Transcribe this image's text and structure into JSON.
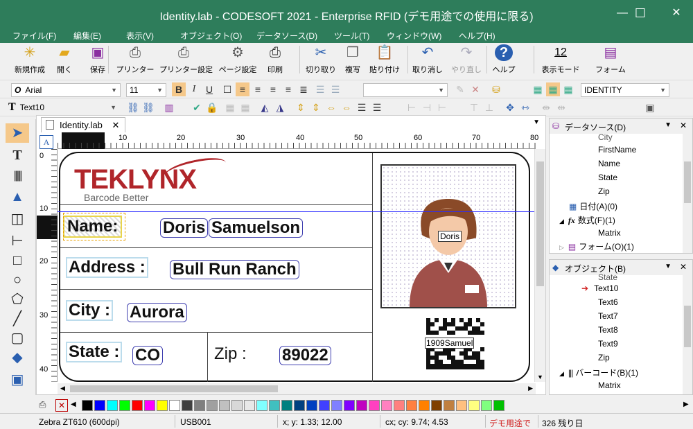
{
  "window": {
    "title": "Identity.lab - CODESOFT 2021 - Enterprise RFID (デモ用途での使用に限る)",
    "minimize": "—",
    "maximize": "☐",
    "close": "✕"
  },
  "menu": [
    "ファイル(F)",
    "編集(E)",
    "表示(V)",
    "オブジェクト(O)",
    "データソース(D)",
    "ツール(T)",
    "ウィンドウ(W)",
    "ヘルプ(H)"
  ],
  "toolbar": {
    "new": "新規作成",
    "open": "開く",
    "save": "保存",
    "printer": "プリンター",
    "printer_settings": "プリンター設定",
    "page_settings": "ページ設定",
    "print": "印刷",
    "cut": "切り取り",
    "copy": "複写",
    "paste": "貼り付け",
    "undo": "取り消し",
    "redo": "やり直し",
    "help": "ヘルプ",
    "display_mode": "表示モード",
    "form": "フォーム",
    "display_mode_icon": "12"
  },
  "format": {
    "font": "Arial",
    "size": "11",
    "identity": "IDENTITY",
    "object_name": "Text10"
  },
  "document": {
    "tab": "Identity.lab"
  },
  "ruler": {
    "h": [
      "0",
      "10",
      "20",
      "30",
      "40",
      "50",
      "60",
      "70",
      "80"
    ],
    "v": [
      "0",
      "10",
      "20",
      "30",
      "40"
    ]
  },
  "label": {
    "logo": "TEKLYNX",
    "slogan": "Barcode Better",
    "name_label": "Name:",
    "first_name": "Doris",
    "last_name": "Samuelson",
    "address_label": "Address :",
    "address": "Bull Run Ranch",
    "city_label": "City :",
    "city": "Aurora",
    "state_label": "State :",
    "state": "CO",
    "zip_label": "Zip :",
    "zip": "89022",
    "badge": "Doris",
    "barcode_text": "1909Samuel"
  },
  "datasource_panel": {
    "title": "データソース(D)",
    "items": [
      "City",
      "FirstName",
      "Name",
      "State",
      "Zip",
      "日付(A)(0)",
      "数式(F)(1)",
      "Matrix",
      "フォーム(O)(1)"
    ]
  },
  "object_panel": {
    "title": "オブジェクト(B)",
    "items": [
      "State",
      "Text10",
      "Text6",
      "Text7",
      "Text8",
      "Text9",
      "Zip",
      "バーコード(B)(1)",
      "Matrix"
    ]
  },
  "status": {
    "printer": "Zebra ZT610 (600dpi)",
    "port": "USB001",
    "xy": "x; y: 1.33; 12.00",
    "cxcy": "cx; cy: 9.74; 4.53",
    "demo": "デモ用途で",
    "days": "326 残り日"
  },
  "palette": [
    "#000000",
    "#0000ff",
    "#00ffff",
    "#00ff00",
    "#ff0000",
    "#ff00ff",
    "#ffff00",
    "#ffffff",
    "#404040",
    "#808080",
    "#a0a0a0",
    "#c0c0c0",
    "#d8d8d8",
    "#e8e8e8",
    "#80ffff",
    "#40c0c0",
    "#008080",
    "#004080",
    "#0040c0",
    "#4040ff",
    "#8080ff",
    "#8000ff",
    "#c000c0",
    "#ff40c0",
    "#ff80c0",
    "#ff8080",
    "#ff8040",
    "#ff8000",
    "#804000",
    "#c08040",
    "#ffc080",
    "#ffff80",
    "#80ff80",
    "#00c000"
  ]
}
